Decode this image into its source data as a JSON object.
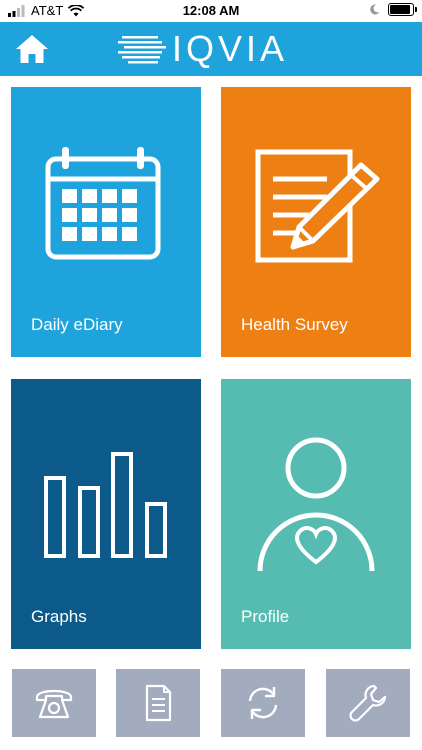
{
  "status_bar": {
    "carrier": "AT&T",
    "time": "12:08 AM"
  },
  "header": {
    "logo_text": "IQVIA",
    "home_icon": "home-icon",
    "color": "#1ea3dc"
  },
  "tiles": [
    {
      "label": "Daily eDiary",
      "icon": "calendar-icon",
      "color": "#1ea3dc"
    },
    {
      "label": "Health Survey",
      "icon": "document-pencil-icon",
      "color": "#ee7f12"
    },
    {
      "label": "Graphs",
      "icon": "bar-chart-icon",
      "color": "#0b5a89"
    },
    {
      "label": "Profile",
      "icon": "person-heart-icon",
      "color": "#56bcb2"
    }
  ],
  "bottom_buttons": [
    {
      "icon": "phone-icon"
    },
    {
      "icon": "document-icon"
    },
    {
      "icon": "sync-icon"
    },
    {
      "icon": "wrench-icon"
    }
  ],
  "colors": {
    "bottom_button": "#a3abbe",
    "background": "#ffffff"
  }
}
